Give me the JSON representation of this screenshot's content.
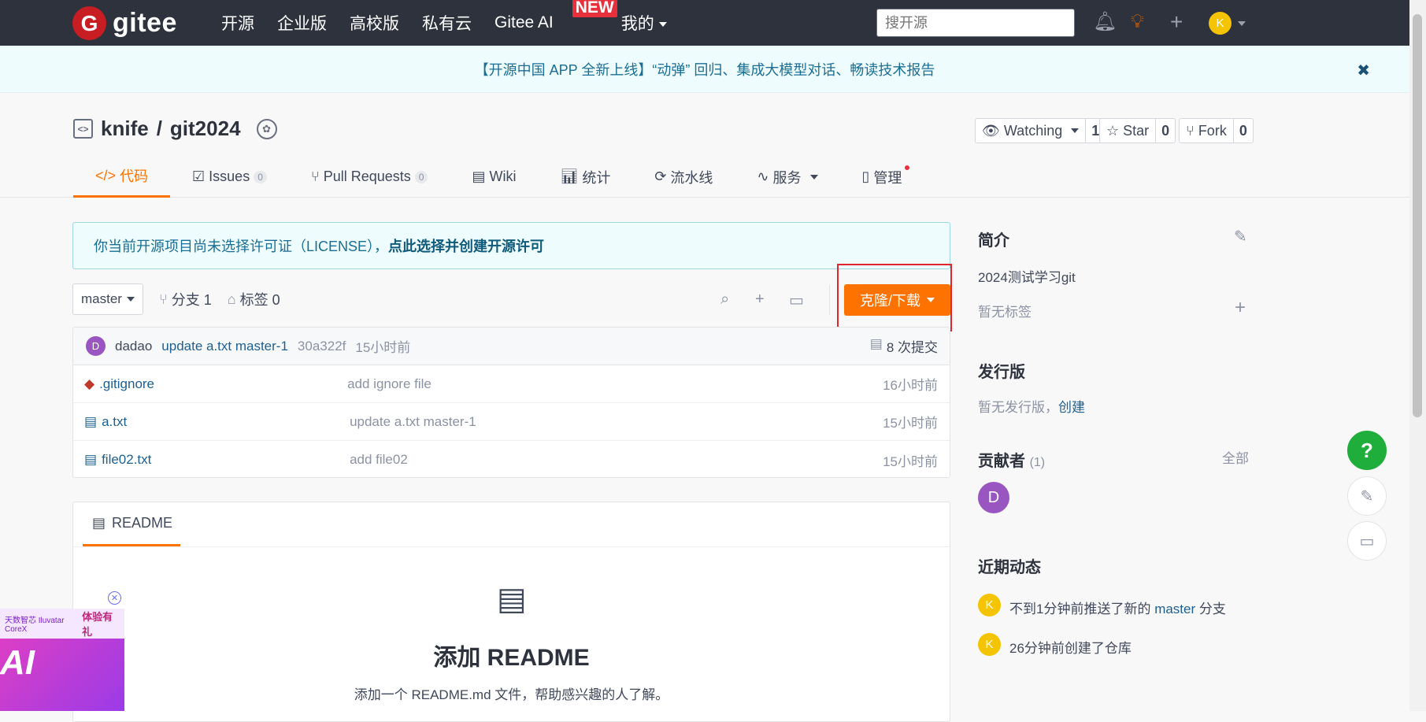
{
  "topbar": {
    "brand": "gitee",
    "nav": [
      "开源",
      "企业版",
      "高校版",
      "私有云",
      "Gitee AI",
      "我的"
    ],
    "new_badge": "NEW",
    "search_placeholder": "搜开源",
    "avatar": "K"
  },
  "banner": {
    "text": "【开源中国 APP 全新上线】“动弹” 回归、集成大模型对话、畅读技术报告",
    "close": "✖"
  },
  "repo": {
    "owner": "knife",
    "sep": "/",
    "name": "git2024",
    "watching_label": "Watching",
    "watching_count": "1",
    "star_label": "Star",
    "star_count": "0",
    "fork_label": "Fork",
    "fork_count": "0"
  },
  "tabs": [
    {
      "label": "代码",
      "icon": "code-icon"
    },
    {
      "label": "Issues",
      "count": "0",
      "icon": "issues-icon"
    },
    {
      "label": "Pull Requests",
      "count": "0",
      "icon": "pull-request-icon"
    },
    {
      "label": "Wiki",
      "icon": "wiki-icon"
    },
    {
      "label": "统计",
      "icon": "chart-icon"
    },
    {
      "label": "流水线",
      "icon": "pipeline-icon"
    },
    {
      "label": "服务",
      "icon": "service-icon"
    },
    {
      "label": "管理",
      "icon": "manage-icon"
    }
  ],
  "license": {
    "text": "你当前开源项目尚未选择许可证（LICENSE），",
    "link": "点此选择并创建开源许可"
  },
  "branchbar": {
    "branch": "master",
    "branches": "分支 1",
    "tags": "标签 0",
    "clone": "克隆/下载"
  },
  "commit": {
    "avatar": "D",
    "author": "dadao",
    "message": "update a.txt master-1",
    "sha": "30a322f",
    "time": "15小时前",
    "count": "8 次提交"
  },
  "files": [
    {
      "name": ".gitignore",
      "msg": "add ignore file",
      "time": "16小时前",
      "icon": "git-icon"
    },
    {
      "name": "a.txt",
      "msg": "update a.txt master-1",
      "time": "15小时前",
      "icon": "file-icon"
    },
    {
      "name": "file02.txt",
      "msg": "add file02",
      "time": "15小时前",
      "icon": "file-icon"
    }
  ],
  "readme": {
    "tab": "README",
    "title": "添加 README",
    "subtitle": "添加一个 README.md 文件，帮助感兴趣的人了解。"
  },
  "sidebar": {
    "intro_title": "简介",
    "intro_text": "2024测试学习git",
    "no_tags": "暂无标签",
    "release_title": "发行版",
    "no_release": "暂无发行版，",
    "create": "创建",
    "contrib_title": "贡献者",
    "contrib_count": "(1)",
    "all": "全部",
    "contrib_avatar": "D",
    "activity_title": "近期动态",
    "activities": [
      {
        "avatar": "K",
        "pre": "不到1分钟前推送了新的 ",
        "link": "master",
        "post": " 分支"
      },
      {
        "avatar": "K",
        "pre": "26分钟前创建了仓库",
        "link": "",
        "post": ""
      }
    ]
  },
  "ad": {
    "brand": "天数智芯 Iluvatar CoreX",
    "promo": "体验有礼",
    "big": "AI"
  }
}
